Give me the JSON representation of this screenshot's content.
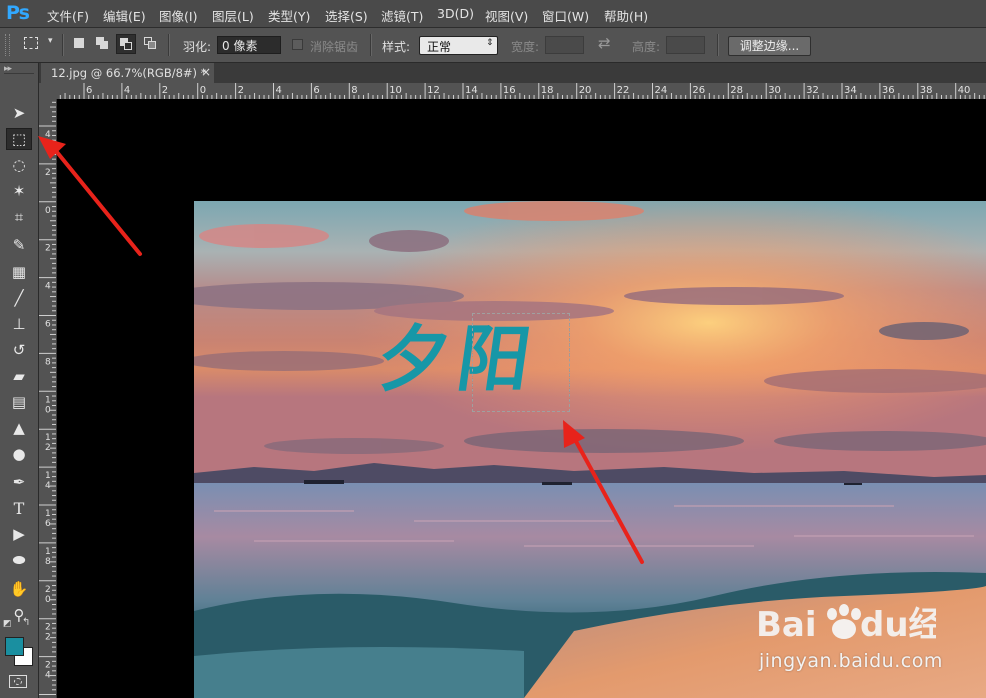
{
  "app": {
    "logo": "Ps"
  },
  "menu": [
    "文件(F)",
    "编辑(E)",
    "图像(I)",
    "图层(L)",
    "类型(Y)",
    "选择(S)",
    "滤镜(T)",
    "3D(D)",
    "视图(V)",
    "窗口(W)",
    "帮助(H)"
  ],
  "options": {
    "feather_label": "羽化:",
    "feather_value": "0 像素",
    "antialias_label": "消除锯齿",
    "style_label": "样式:",
    "style_value": "正常",
    "width_label": "宽度:",
    "height_label": "高度:",
    "refine_edge_button": "调整边缘..."
  },
  "document": {
    "tab_title": "12.jpg @ 66.7%(RGB/8#) *",
    "close_glyph": "×"
  },
  "rulers": {
    "horizontal": [
      "6",
      "4",
      "2",
      "0",
      "2",
      "4",
      "6",
      "8",
      "10",
      "12",
      "14",
      "16",
      "18",
      "20",
      "22",
      "24",
      "26",
      "28",
      "30",
      "32",
      "34",
      "36",
      "38",
      "40"
    ],
    "vertical": [
      "4",
      "2",
      "0",
      "2",
      "4",
      "6",
      "8",
      "10",
      "12",
      "14",
      "16",
      "18",
      "20",
      "22",
      "24"
    ]
  },
  "artwork": {
    "text": "夕阳",
    "text_color": "#1797a7"
  },
  "watermark": {
    "logo": "Baidu经验",
    "url": "jingyan.baidu.com"
  },
  "colors": {
    "foreground": "#1a8fa0",
    "background": "#ffffff",
    "accent": "#31a8ff",
    "arrow": "#e8231b"
  },
  "tools": [
    "move-tool",
    "rectangular-marquee-tool",
    "lasso-tool",
    "magic-wand-tool",
    "crop-tool",
    "eyedropper-tool",
    "spot-healing-tool",
    "brush-tool",
    "clone-stamp-tool",
    "history-brush-tool",
    "eraser-tool",
    "gradient-tool",
    "blur-tool",
    "dodge-tool",
    "pen-tool",
    "type-tool",
    "path-selection-tool",
    "ellipse-tool",
    "hand-tool",
    "zoom-tool"
  ],
  "active_tool": "rectangular-marquee-tool"
}
